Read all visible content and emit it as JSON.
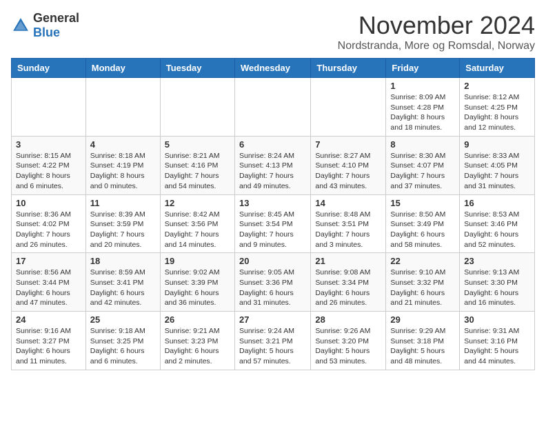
{
  "header": {
    "logo": {
      "text_general": "General",
      "text_blue": "Blue"
    },
    "title": "November 2024",
    "subtitle": "Nordstranda, More og Romsdal, Norway"
  },
  "calendar": {
    "weekdays": [
      "Sunday",
      "Monday",
      "Tuesday",
      "Wednesday",
      "Thursday",
      "Friday",
      "Saturday"
    ],
    "weeks": [
      [
        {
          "day": "",
          "info": ""
        },
        {
          "day": "",
          "info": ""
        },
        {
          "day": "",
          "info": ""
        },
        {
          "day": "",
          "info": ""
        },
        {
          "day": "",
          "info": ""
        },
        {
          "day": "1",
          "info": "Sunrise: 8:09 AM\nSunset: 4:28 PM\nDaylight: 8 hours and 18 minutes."
        },
        {
          "day": "2",
          "info": "Sunrise: 8:12 AM\nSunset: 4:25 PM\nDaylight: 8 hours and 12 minutes."
        }
      ],
      [
        {
          "day": "3",
          "info": "Sunrise: 8:15 AM\nSunset: 4:22 PM\nDaylight: 8 hours and 6 minutes."
        },
        {
          "day": "4",
          "info": "Sunrise: 8:18 AM\nSunset: 4:19 PM\nDaylight: 8 hours and 0 minutes."
        },
        {
          "day": "5",
          "info": "Sunrise: 8:21 AM\nSunset: 4:16 PM\nDaylight: 7 hours and 54 minutes."
        },
        {
          "day": "6",
          "info": "Sunrise: 8:24 AM\nSunset: 4:13 PM\nDaylight: 7 hours and 49 minutes."
        },
        {
          "day": "7",
          "info": "Sunrise: 8:27 AM\nSunset: 4:10 PM\nDaylight: 7 hours and 43 minutes."
        },
        {
          "day": "8",
          "info": "Sunrise: 8:30 AM\nSunset: 4:07 PM\nDaylight: 7 hours and 37 minutes."
        },
        {
          "day": "9",
          "info": "Sunrise: 8:33 AM\nSunset: 4:05 PM\nDaylight: 7 hours and 31 minutes."
        }
      ],
      [
        {
          "day": "10",
          "info": "Sunrise: 8:36 AM\nSunset: 4:02 PM\nDaylight: 7 hours and 26 minutes."
        },
        {
          "day": "11",
          "info": "Sunrise: 8:39 AM\nSunset: 3:59 PM\nDaylight: 7 hours and 20 minutes."
        },
        {
          "day": "12",
          "info": "Sunrise: 8:42 AM\nSunset: 3:56 PM\nDaylight: 7 hours and 14 minutes."
        },
        {
          "day": "13",
          "info": "Sunrise: 8:45 AM\nSunset: 3:54 PM\nDaylight: 7 hours and 9 minutes."
        },
        {
          "day": "14",
          "info": "Sunrise: 8:48 AM\nSunset: 3:51 PM\nDaylight: 7 hours and 3 minutes."
        },
        {
          "day": "15",
          "info": "Sunrise: 8:50 AM\nSunset: 3:49 PM\nDaylight: 6 hours and 58 minutes."
        },
        {
          "day": "16",
          "info": "Sunrise: 8:53 AM\nSunset: 3:46 PM\nDaylight: 6 hours and 52 minutes."
        }
      ],
      [
        {
          "day": "17",
          "info": "Sunrise: 8:56 AM\nSunset: 3:44 PM\nDaylight: 6 hours and 47 minutes."
        },
        {
          "day": "18",
          "info": "Sunrise: 8:59 AM\nSunset: 3:41 PM\nDaylight: 6 hours and 42 minutes."
        },
        {
          "day": "19",
          "info": "Sunrise: 9:02 AM\nSunset: 3:39 PM\nDaylight: 6 hours and 36 minutes."
        },
        {
          "day": "20",
          "info": "Sunrise: 9:05 AM\nSunset: 3:36 PM\nDaylight: 6 hours and 31 minutes."
        },
        {
          "day": "21",
          "info": "Sunrise: 9:08 AM\nSunset: 3:34 PM\nDaylight: 6 hours and 26 minutes."
        },
        {
          "day": "22",
          "info": "Sunrise: 9:10 AM\nSunset: 3:32 PM\nDaylight: 6 hours and 21 minutes."
        },
        {
          "day": "23",
          "info": "Sunrise: 9:13 AM\nSunset: 3:30 PM\nDaylight: 6 hours and 16 minutes."
        }
      ],
      [
        {
          "day": "24",
          "info": "Sunrise: 9:16 AM\nSunset: 3:27 PM\nDaylight: 6 hours and 11 minutes."
        },
        {
          "day": "25",
          "info": "Sunrise: 9:18 AM\nSunset: 3:25 PM\nDaylight: 6 hours and 6 minutes."
        },
        {
          "day": "26",
          "info": "Sunrise: 9:21 AM\nSunset: 3:23 PM\nDaylight: 6 hours and 2 minutes."
        },
        {
          "day": "27",
          "info": "Sunrise: 9:24 AM\nSunset: 3:21 PM\nDaylight: 5 hours and 57 minutes."
        },
        {
          "day": "28",
          "info": "Sunrise: 9:26 AM\nSunset: 3:20 PM\nDaylight: 5 hours and 53 minutes."
        },
        {
          "day": "29",
          "info": "Sunrise: 9:29 AM\nSunset: 3:18 PM\nDaylight: 5 hours and 48 minutes."
        },
        {
          "day": "30",
          "info": "Sunrise: 9:31 AM\nSunset: 3:16 PM\nDaylight: 5 hours and 44 minutes."
        }
      ]
    ]
  }
}
